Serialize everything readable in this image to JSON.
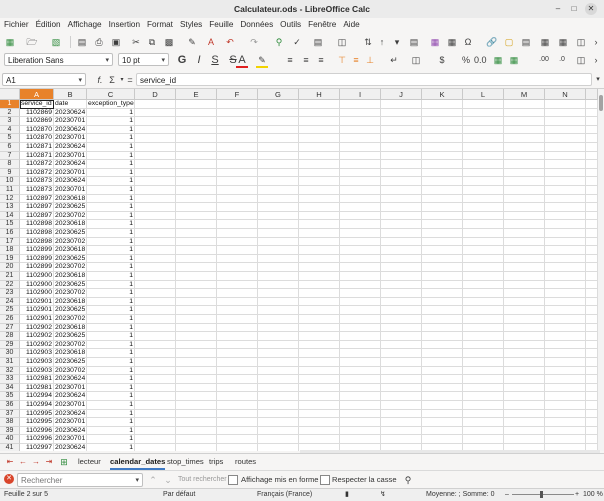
{
  "window": {
    "title": "Calculateur.ods - LibreOffice Calc"
  },
  "menu": [
    "Fichier",
    "Édition",
    "Affichage",
    "Insertion",
    "Format",
    "Styles",
    "Feuille",
    "Données",
    "Outils",
    "Fenêtre",
    "Aide"
  ],
  "toolbar": {
    "font_name": "Liberation Sans",
    "font_size": "10 pt"
  },
  "formula_bar": {
    "name_box": "A1",
    "content": "service_id"
  },
  "columns": [
    "A",
    "B",
    "C",
    "D",
    "E",
    "F",
    "G",
    "H",
    "I",
    "J",
    "K",
    "L",
    "M",
    "N"
  ],
  "header_row": [
    "service_id",
    "date",
    "exception_type"
  ],
  "rows": [
    {
      "n": "2",
      "a": "1102869",
      "b": "20230624",
      "c": "1"
    },
    {
      "n": "3",
      "a": "1102869",
      "b": "20230701",
      "c": "1"
    },
    {
      "n": "4",
      "a": "1102870",
      "b": "20230624",
      "c": "1"
    },
    {
      "n": "5",
      "a": "1102870",
      "b": "20230701",
      "c": "1"
    },
    {
      "n": "6",
      "a": "1102871",
      "b": "20230624",
      "c": "1"
    },
    {
      "n": "7",
      "a": "1102871",
      "b": "20230701",
      "c": "1"
    },
    {
      "n": "8",
      "a": "1102872",
      "b": "20230624",
      "c": "1"
    },
    {
      "n": "9",
      "a": "1102872",
      "b": "20230701",
      "c": "1"
    },
    {
      "n": "10",
      "a": "1102873",
      "b": "20230624",
      "c": "1"
    },
    {
      "n": "11",
      "a": "1102873",
      "b": "20230701",
      "c": "1"
    },
    {
      "n": "12",
      "a": "1102897",
      "b": "20230618",
      "c": "1"
    },
    {
      "n": "13",
      "a": "1102897",
      "b": "20230625",
      "c": "1"
    },
    {
      "n": "14",
      "a": "1102897",
      "b": "20230702",
      "c": "1"
    },
    {
      "n": "15",
      "a": "1102898",
      "b": "20230618",
      "c": "1"
    },
    {
      "n": "16",
      "a": "1102898",
      "b": "20230625",
      "c": "1"
    },
    {
      "n": "17",
      "a": "1102898",
      "b": "20230702",
      "c": "1"
    },
    {
      "n": "18",
      "a": "1102899",
      "b": "20230618",
      "c": "1"
    },
    {
      "n": "19",
      "a": "1102899",
      "b": "20230625",
      "c": "1"
    },
    {
      "n": "20",
      "a": "1102899",
      "b": "20230702",
      "c": "1"
    },
    {
      "n": "21",
      "a": "1102900",
      "b": "20230618",
      "c": "1"
    },
    {
      "n": "22",
      "a": "1102900",
      "b": "20230625",
      "c": "1"
    },
    {
      "n": "23",
      "a": "1102900",
      "b": "20230702",
      "c": "1"
    },
    {
      "n": "24",
      "a": "1102901",
      "b": "20230618",
      "c": "1"
    },
    {
      "n": "25",
      "a": "1102901",
      "b": "20230625",
      "c": "1"
    },
    {
      "n": "26",
      "a": "1102901",
      "b": "20230702",
      "c": "1"
    },
    {
      "n": "27",
      "a": "1102902",
      "b": "20230618",
      "c": "1"
    },
    {
      "n": "28",
      "a": "1102902",
      "b": "20230625",
      "c": "1"
    },
    {
      "n": "29",
      "a": "1102902",
      "b": "20230702",
      "c": "1"
    },
    {
      "n": "30",
      "a": "1102903",
      "b": "20230618",
      "c": "1"
    },
    {
      "n": "31",
      "a": "1102903",
      "b": "20230625",
      "c": "1"
    },
    {
      "n": "32",
      "a": "1102903",
      "b": "20230702",
      "c": "1"
    },
    {
      "n": "33",
      "a": "1102981",
      "b": "20230624",
      "c": "1"
    },
    {
      "n": "34",
      "a": "1102981",
      "b": "20230701",
      "c": "1"
    },
    {
      "n": "35",
      "a": "1102994",
      "b": "20230624",
      "c": "1"
    },
    {
      "n": "36",
      "a": "1102994",
      "b": "20230701",
      "c": "1"
    },
    {
      "n": "37",
      "a": "1102995",
      "b": "20230624",
      "c": "1"
    },
    {
      "n": "38",
      "a": "1102995",
      "b": "20230701",
      "c": "1"
    },
    {
      "n": "39",
      "a": "1102996",
      "b": "20230624",
      "c": "1"
    },
    {
      "n": "40",
      "a": "1102996",
      "b": "20230701",
      "c": "1"
    },
    {
      "n": "41",
      "a": "1102997",
      "b": "20230624",
      "c": "1"
    }
  ],
  "sheet_tabs": [
    "lecteur",
    "calendar_dates",
    "stop_times",
    "trips",
    "routes"
  ],
  "active_tab": "calendar_dates",
  "find": {
    "placeholder": "Rechercher",
    "find_all": "Tout rechercher",
    "formatted": "Affichage mis en forme",
    "match_case": "Respecter la casse"
  },
  "status": {
    "sheet": "Feuille 2 sur 5",
    "style": "Par défaut",
    "language": "Français (France)",
    "summary": "Moyenne: ; Somme: 0",
    "zoom": "100 %"
  },
  "colors": {
    "accent": "#e8822a",
    "tab_underline": "#3f7ac4"
  }
}
